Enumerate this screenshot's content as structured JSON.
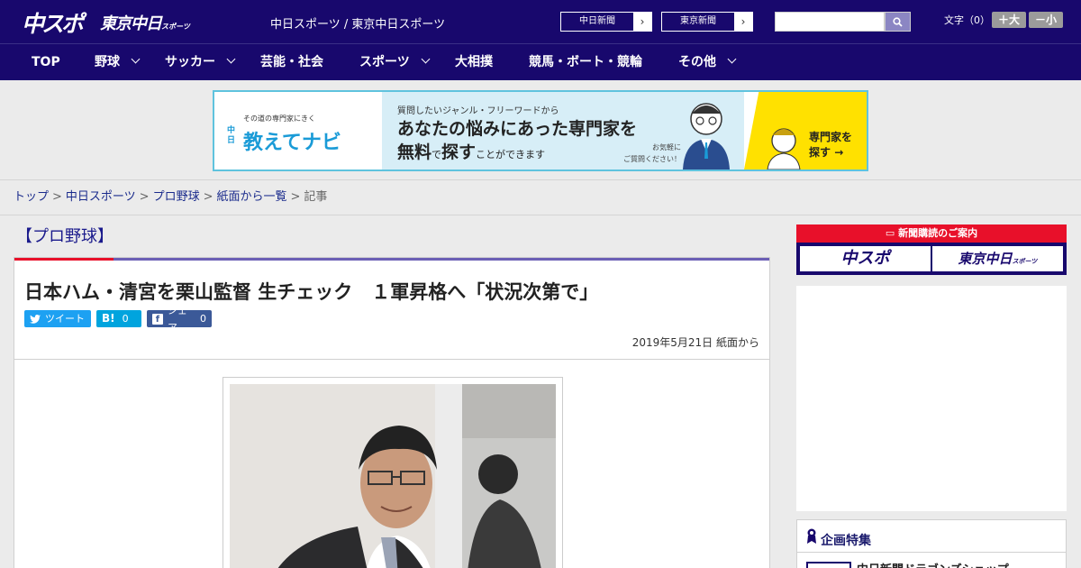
{
  "header": {
    "logo_main": "中スポ",
    "logo_tokyo": "東京中日",
    "logo_tokyo_small": "スポーツ",
    "tagline": "中日スポーツ / 東京中日スポーツ",
    "paper_links": [
      "中日新聞",
      "東京新聞"
    ],
    "font_size_label": "文字（0）",
    "font_larger": "＋大",
    "font_smaller": "－小"
  },
  "nav": {
    "items": [
      {
        "label": "TOP",
        "dropdown": false
      },
      {
        "label": "野球",
        "dropdown": true
      },
      {
        "label": "サッカー",
        "dropdown": true
      },
      {
        "label": "芸能・社会",
        "dropdown": false
      },
      {
        "label": "スポーツ",
        "dropdown": true
      },
      {
        "label": "大相撲",
        "dropdown": false
      },
      {
        "label": "競馬・ボート・競輪",
        "dropdown": false
      },
      {
        "label": "その他",
        "dropdown": true
      }
    ]
  },
  "ad_banner": {
    "sub": "その道の専門家にきく",
    "brand_mark": "中日",
    "brand": "教えてナビ",
    "line1": "質問したいジャンル・フリーワードから",
    "line2": "あなたの悩みにあった専門家を",
    "line3_a": "無料",
    "line3_b": "で",
    "line3_c": "探す",
    "line3_d": "ことができます",
    "note1": "お気軽に",
    "note2": "ご質問ください！",
    "cta1": "専門家を",
    "cta2": "探す"
  },
  "breadcrumb": {
    "items": [
      "トップ",
      "中日スポーツ",
      "プロ野球",
      "紙面から一覧"
    ],
    "current": "記事"
  },
  "article": {
    "section": "【プロ野球】",
    "headline": "日本ハム・清宮を栗山監督 生チェック　１軍昇格へ「状況次第で」",
    "tweet_label": "ツイート",
    "hatena_label": "B!",
    "hatena_count": "0",
    "share_label": "シェア",
    "share_count": "0",
    "date": "2019年5月21日 紙面から"
  },
  "sidebar": {
    "subscription_head": "新聞購読のご案内",
    "subscription_btn1": "中スポ",
    "subscription_btn2": "東京中日",
    "subscription_btn2_small": "スポーツ",
    "feature_title": "企画特集",
    "feature_item": "中日新聞ドラゴンズショップ"
  },
  "colors": {
    "brand_navy": "#18086d",
    "accent_red": "#e8102a",
    "accent_purple": "#6c5fb5",
    "banner_border": "#5fc3de",
    "banner_yellow": "#ffe100"
  }
}
